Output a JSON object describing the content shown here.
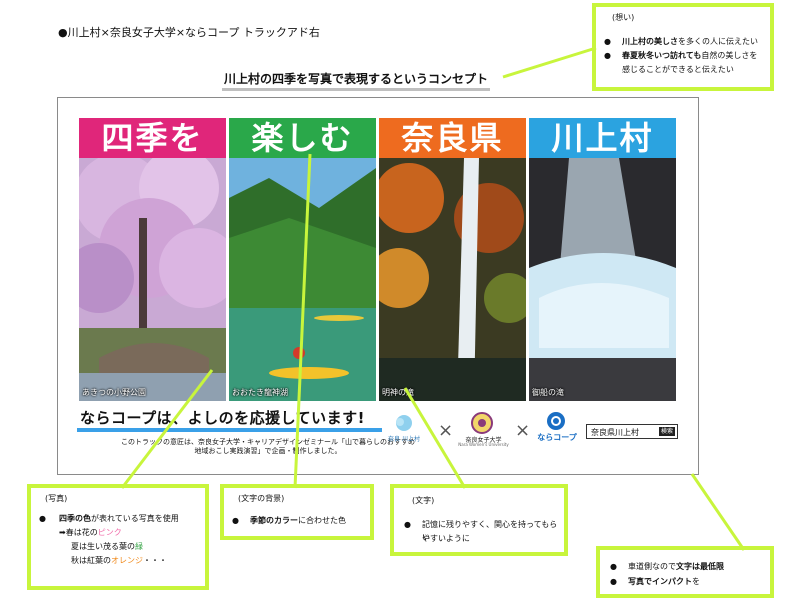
{
  "header": {
    "title": "●川上村×奈良女子大学×ならコープ トラックアド右"
  },
  "concept": {
    "text": "川上村の四季を写真で表現するというコンセプト"
  },
  "panels": [
    {
      "title": "四季を",
      "caption": "あきつの小野公園",
      "color": "#e0267a"
    },
    {
      "title": "楽しむ",
      "caption": "おおたき龍神湖",
      "color": "#2aa84a"
    },
    {
      "title": "奈良県",
      "caption": "明神の滝",
      "color": "#ee6b1f"
    },
    {
      "title": "川上村",
      "caption": "御船の滝",
      "color": "#2ba3e0"
    }
  ],
  "ad": {
    "slogan_part1": "ならコープは",
    "slogan_part2": "、よしのを応援しています!",
    "description": "このトラックの意匠は、奈良女子大学・キャリアデザインゼミナール「山で暮らしのおすすめ 地域おこし実践演習」で企画・制作しました。",
    "logo1": "奈良 川上村",
    "logo2_main": "奈良女子大学",
    "logo2_sub": "Nara Women's University",
    "logo3": "ならコープ",
    "times": "×",
    "search_text": "奈良県川上村",
    "search_button": "検索"
  },
  "notes": {
    "thought": {
      "title": "(想い)",
      "item1_bold": "川上村の美しさ",
      "item1_rest": "を多くの人に伝えたい",
      "item2_bold": "春夏秋冬いつ訪れても",
      "item2_rest": "自然の美しさを",
      "item2_cont": "感じることができると伝えたい"
    },
    "photo": {
      "title": "(写真)",
      "line1_bold": "四季の色",
      "line1_rest": "が表れている写真を使用",
      "line2_pre": "➡春は",
      "line2_a": "花の",
      "line2_b": "ピンク",
      "line3_pre": "夏は生い茂る葉の",
      "line3_b": "緑",
      "line4_pre": "秋は",
      "line4_a": "紅葉の",
      "line4_b": "オレンジ",
      "line4_post": "・・・"
    },
    "background": {
      "title": "(文字の背景)",
      "item_bold": "季節のカラー",
      "item_rest": "に合わせた色"
    },
    "text": {
      "title": "(文字)",
      "line1": "記憶に残りやすく、関心を持ってもらい",
      "line2": "やすいように"
    },
    "road": {
      "item1_pre": "車道側なので",
      "item1_bold": "文字は最低限",
      "item2_bold": "写真でインパクト",
      "item2_rest": "を"
    }
  },
  "colors": {
    "note_border": "#c8f53c",
    "pink": "#f06aa8",
    "green": "#3aa64a",
    "orange": "#f08a1c",
    "blue_line": "#3aa0e8"
  }
}
